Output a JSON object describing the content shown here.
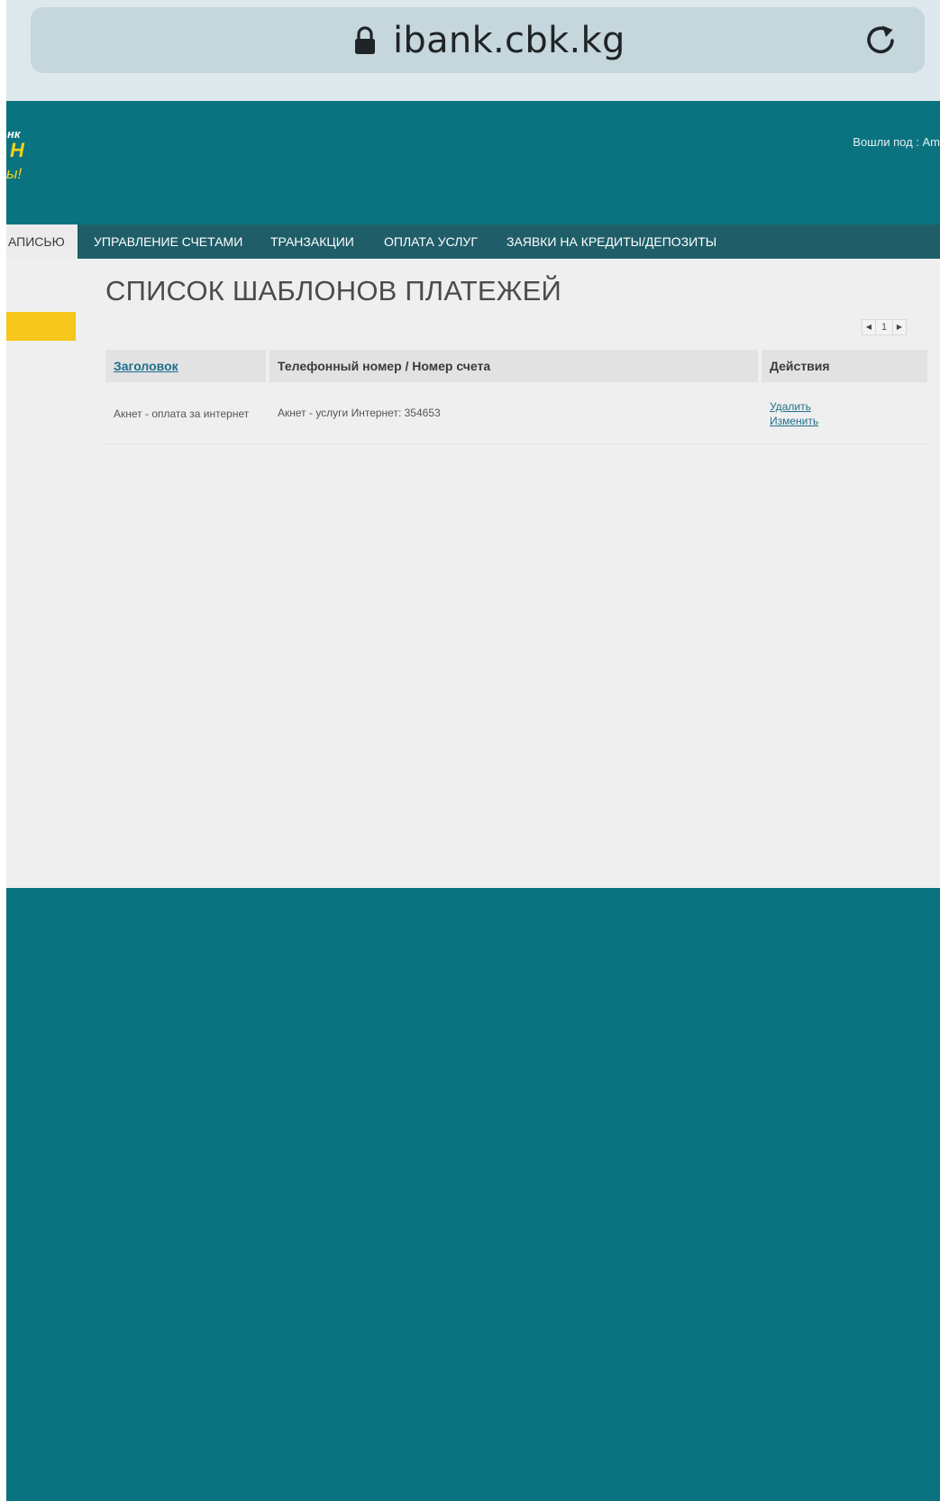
{
  "browser": {
    "url": "ibank.cbk.kg",
    "lock_icon": "lock-icon",
    "reload_icon": "reload-icon"
  },
  "header": {
    "logo_line1": "нк",
    "logo_line2": "Н",
    "logo_line3": "ы!",
    "user_label": "Вошли под : Am"
  },
  "nav": {
    "items": [
      {
        "label": "АПИСЬЮ",
        "active": true
      },
      {
        "label": "УПРАВЛЕНИЕ СЧЕТАМИ",
        "active": false
      },
      {
        "label": "ТРАНЗАКЦИИ",
        "active": false
      },
      {
        "label": "ОПЛАТА УСЛУГ",
        "active": false
      },
      {
        "label": "ЗАЯВКИ НА КРЕДИТЫ/ДЕПОЗИТЫ",
        "active": false
      }
    ]
  },
  "main": {
    "title": "СПИСОК ШАБЛОНОВ ПЛАТЕЖЕЙ",
    "pager": {
      "prev": "◀",
      "page": "1",
      "next": "▶"
    },
    "table": {
      "headers": [
        "Заголовок",
        "Телефонный номер / Номер счета",
        "Действия"
      ],
      "rows": [
        {
          "title": "Акнет - оплата за интернет",
          "account": "Акнет - услуги Интернет: 354653",
          "actions": [
            "Удалить",
            "Изменить"
          ]
        }
      ]
    }
  },
  "colors": {
    "brand": "#0b7380",
    "nav": "#1f5e69",
    "accent": "#f6c61a",
    "link": "#1f6f8b"
  }
}
